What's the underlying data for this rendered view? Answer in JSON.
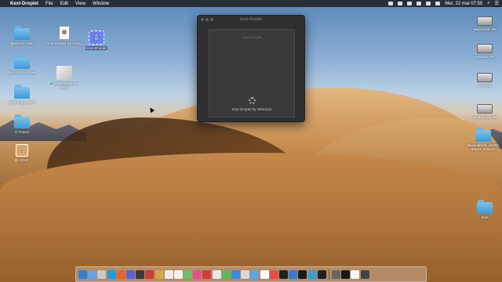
{
  "menubar": {
    "app_name": "Kext-Droplet",
    "menus": [
      "File",
      "Edit",
      "View",
      "Window"
    ],
    "clock": "Mer. 22 mai  07:55"
  },
  "desktop_left": [
    {
      "label": "BUILD-CSE",
      "icon": "folder-icon",
      "tag_color": "#f5c242"
    },
    {
      "label": "Mes Programmes",
      "icon": "folder-icon"
    },
    {
      "label": "EDP Image 10.X",
      "icon": "folder-icon"
    },
    {
      "label": "Travail",
      "icon": "folder-icon",
      "tag_color": "#4cbf4c"
    },
    {
      "label": "LIENS",
      "icon": "link-app-icon",
      "tag_color": "#f5c242"
    }
  ],
  "desktop_mid": [
    {
      "label": "Kext-Droplet V1.1.dmg",
      "icon": "dmg-icon"
    },
    {
      "label": "Kext-Droplet",
      "icon": "droplet-app-icon"
    },
    {
      "label": "AirPortAtheros4 0.kext",
      "icon": "kext-icon"
    }
  ],
  "desktop_right": [
    {
      "label": "Macintosh HD",
      "icon": "hard-disk-icon"
    },
    {
      "label": "Mojave TB",
      "icon": "hard-disk-icon"
    },
    {
      "label": "Clé USB",
      "icon": "hard-disk-icon"
    },
    {
      "label": "High Sierra HD",
      "icon": "hard-disk-icon"
    },
    {
      "label": "BackupKext_LE201 90622_075610",
      "icon": "folder-icon"
    },
    {
      "label": "Bela",
      "icon": "folder-icon"
    }
  ],
  "window": {
    "title": "Kext-Droplet",
    "drop_label": "Kext-Droplet",
    "byline": "Kext Droplet by chris1111"
  },
  "dock": {
    "item_colors": [
      "#2d7fd8",
      "#6aa0e0",
      "#c9c9c9",
      "#1f9be0",
      "#e8622f",
      "#5a62d8",
      "#3b3b3b",
      "#cf3a3a",
      "#d6a544",
      "#ececec",
      "#f2f2f2",
      "#6ac26a",
      "#e94d8c",
      "#d23b3b",
      "#e8e8e8",
      "#5cb85c",
      "#3a8be0",
      "#d9d9d9",
      "#5aa6e6",
      "#ffffff",
      "#e84a4a",
      "#222222",
      "#2f7fd6",
      "#1a1a1a",
      "#3b9ae0",
      "#222222",
      "#666666",
      "#1a1a1a",
      "#f5f5f5",
      "#444444"
    ]
  }
}
